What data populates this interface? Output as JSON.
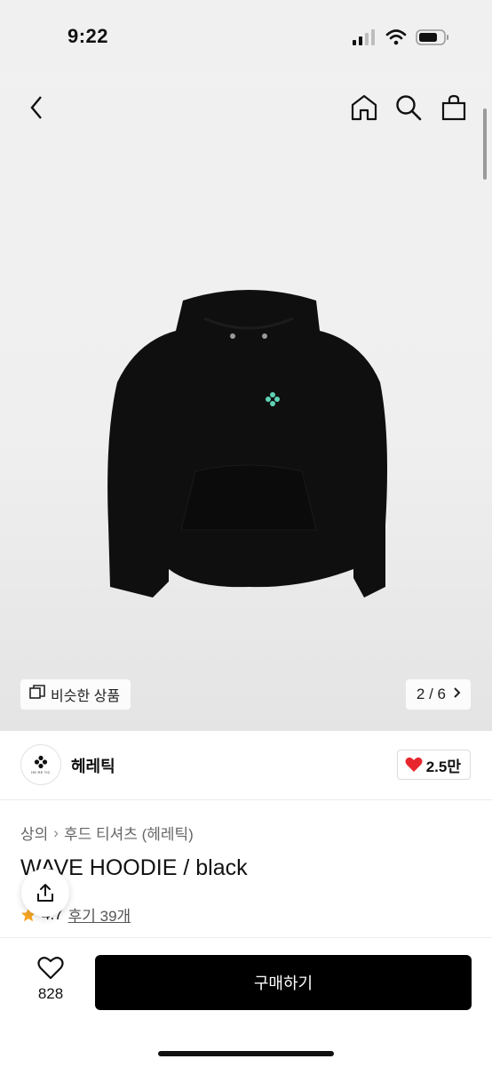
{
  "status_bar": {
    "time": "9:22"
  },
  "similar_chip": {
    "label": "비슷한 상품"
  },
  "gallery": {
    "counter": "2 / 6"
  },
  "brand": {
    "name": "헤레틱",
    "logo_text": "HE RE TIC",
    "likes": "2.5만"
  },
  "breadcrumb": {
    "category": "상의",
    "separator": "›",
    "subcategory": "후드 티셔츠 (헤레틱)"
  },
  "product": {
    "title": "WAVE HOODIE / black",
    "rating": "4.7",
    "reviews_label": "후기 39개"
  },
  "bottom": {
    "wish_count": "828",
    "buy_label": "구매하기"
  },
  "colors": {
    "accent": "#000000",
    "heart": "#e8262d",
    "star": "#f5a623",
    "logo_mint": "#5fd3b4"
  },
  "icons": [
    "back-icon",
    "home-icon",
    "search-icon",
    "bag-icon",
    "similar-icon",
    "chevron-right-icon",
    "heart-icon",
    "star-icon",
    "share-icon"
  ]
}
